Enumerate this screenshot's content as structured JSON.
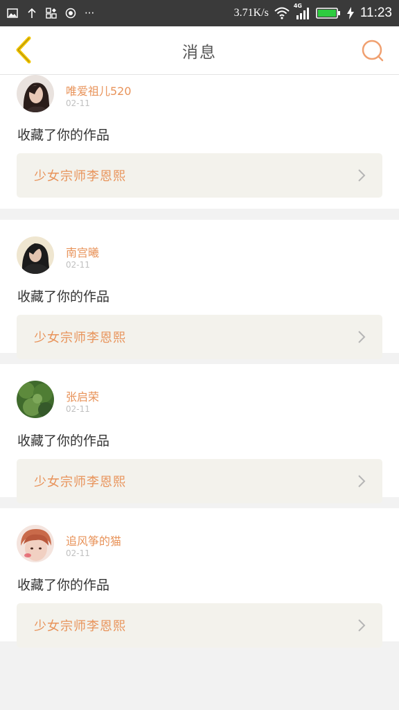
{
  "status_bar": {
    "speed": "3.71K/s",
    "network": "4G",
    "time": "11:23",
    "more": "···"
  },
  "nav": {
    "title": "消息"
  },
  "messages": [
    {
      "user": "唯爱祖儿520",
      "time": "02-11",
      "action": "收藏了你的作品",
      "work": "少女宗师李恩熙"
    },
    {
      "user": "南宫曦",
      "time": "02-11",
      "action": "收藏了你的作品",
      "work": "少女宗师李恩熙"
    },
    {
      "user": "张启荣",
      "time": "02-11",
      "action": "收藏了你的作品",
      "work": "少女宗师李恩熙"
    },
    {
      "user": "追风筝的猫",
      "time": "02-11",
      "action": "收藏了你的作品",
      "work": "少女宗师李恩熙"
    }
  ],
  "colors": {
    "accent": "#e8935a",
    "status_bar": "#3a3a3a",
    "back_arrow": "#f2c500",
    "battery": "#2ecc40"
  }
}
